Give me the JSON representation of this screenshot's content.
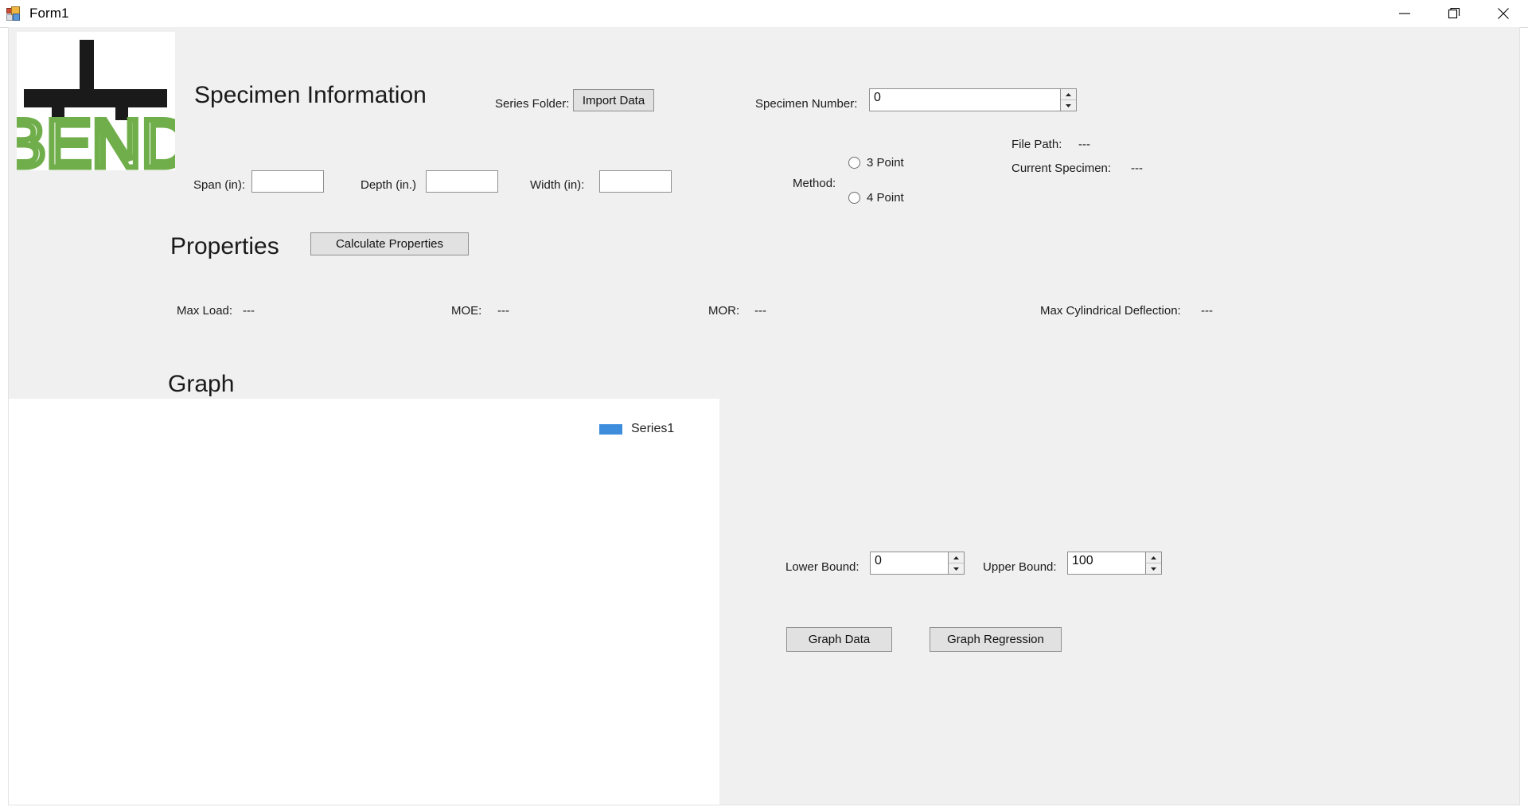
{
  "window": {
    "title": "Form1",
    "icon": "form-designer-icon",
    "buttons": {
      "minimize": "minimize-icon",
      "maximize": "restore-icon",
      "close": "close-icon"
    }
  },
  "logo": {
    "text": "BEND",
    "green": "#6fae4a",
    "black": "#1a1a1a",
    "alt": "BEND beam bending logo"
  },
  "specimen": {
    "heading": "Specimen Information",
    "series_folder_label": "Series Folder:",
    "import_button": "Import Data",
    "specimen_number_label": "Specimen Number:",
    "specimen_number_value": "0",
    "span_label": "Span (in):",
    "span_value": "",
    "depth_label": "Depth (in.)",
    "depth_value": "",
    "width_label": "Width (in):",
    "width_value": "",
    "method_label": "Method:",
    "method_options": [
      {
        "label": "3 Point",
        "selected": false
      },
      {
        "label": "4 Point",
        "selected": false
      }
    ],
    "file_path_label": "File Path:",
    "file_path_value": "---",
    "current_specimen_label": "Current Specimen:",
    "current_specimen_value": "---"
  },
  "properties": {
    "heading": "Properties",
    "calculate_button": "Calculate Properties",
    "max_load_label": "Max Load:",
    "max_load_value": "---",
    "moe_label": "MOE:",
    "moe_value": "---",
    "mor_label": "MOR:",
    "mor_value": "---",
    "max_deflection_label": "Max Cylindrical Deflection:",
    "max_deflection_value": "---"
  },
  "graph": {
    "heading": "Graph",
    "lower_bound_label": "Lower Bound:",
    "lower_bound_value": "0",
    "upper_bound_label": "Upper Bound:",
    "upper_bound_value": "100",
    "graph_data_button": "Graph Data",
    "graph_regression_button": "Graph Regression"
  },
  "chart_data": {
    "type": "line",
    "title": "",
    "xlabel": "",
    "ylabel": "",
    "series": [
      {
        "name": "Series1",
        "color": "#3e8ddd",
        "values": []
      }
    ],
    "legend_position": "top-right",
    "grid": false,
    "plot_empty": true
  }
}
